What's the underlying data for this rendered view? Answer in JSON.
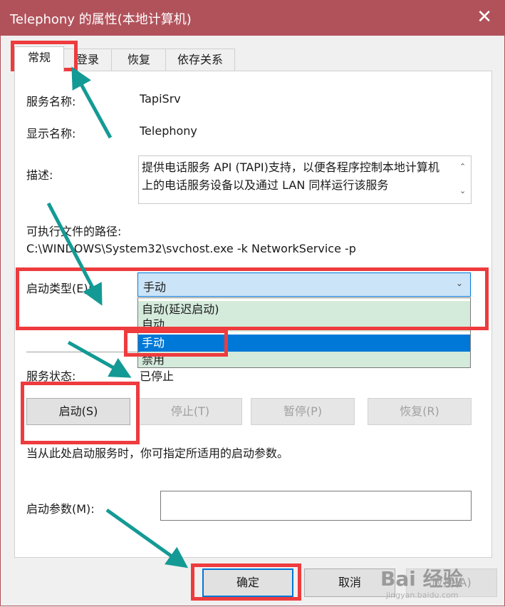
{
  "window": {
    "title": "Telephony 的属性(本地计算机)",
    "close_glyph": "✕"
  },
  "tabs": [
    "常规",
    "登录",
    "恢复",
    "依存关系"
  ],
  "general": {
    "service_name_label": "服务名称:",
    "service_name": "TapiSrv",
    "display_name_label": "显示名称:",
    "display_name": "Telephony",
    "description_label": "描述:",
    "description": "提供电话服务 API (TAPI)支持，以便各程序控制本地计算机上的电话服务设备以及通过 LAN 同样运行该服务",
    "path_label": "可执行文件的路径:",
    "path": "C:\\WINDOWS\\System32\\svchost.exe -k NetworkService -p",
    "startup_type_label": "启动类型(E):",
    "startup_type_value": "手动",
    "startup_options": [
      "自动(延迟启动)",
      "自动",
      "手动",
      "禁用"
    ],
    "status_label": "服务状态:",
    "status_value": "已停止",
    "buttons": {
      "start": "启动(S)",
      "stop": "停止(T)",
      "pause": "暂停(P)",
      "resume": "恢复(R)"
    },
    "hint": "当从此处启动服务时，你可指定所适用的启动参数。",
    "params_label": "启动参数(M):",
    "params_value": ""
  },
  "footer": {
    "ok": "确定",
    "cancel": "取消",
    "apply": "应用(A)"
  },
  "watermark": {
    "brand": "Bai 经验",
    "url": "jingyan.baidu.com"
  },
  "colors": {
    "titlebar": "#b1525b",
    "highlight": "#ee3b3e",
    "arrow": "#149a95",
    "selection": "#0078d7"
  }
}
